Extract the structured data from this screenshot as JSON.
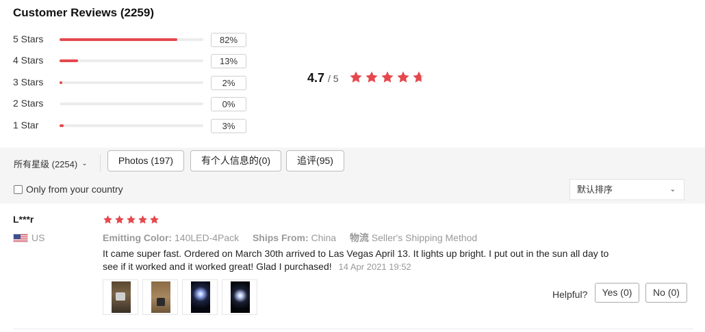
{
  "header": {
    "title": "Customer Reviews (2259)"
  },
  "distribution": [
    {
      "label": "5 Stars",
      "percent_text": "82%",
      "fill_fraction": 0.82
    },
    {
      "label": "4 Stars",
      "percent_text": "13%",
      "fill_fraction": 0.13
    },
    {
      "label": "3 Stars",
      "percent_text": "2%",
      "fill_fraction": 0.02
    },
    {
      "label": "2 Stars",
      "percent_text": "0%",
      "fill_fraction": 0.0
    },
    {
      "label": "1 Star",
      "percent_text": "3%",
      "fill_fraction": 0.03
    }
  ],
  "average": {
    "value": "4.7",
    "out_of": "/ 5",
    "stars_fraction": 0.94
  },
  "filters": {
    "all_stars_select": "所有星级 (2254)",
    "photos_button": "Photos (197)",
    "personal_info_button": "有个人信息的(0)",
    "follow_up_button": "追评(95)",
    "only_country_label": "Only from your country",
    "sort_select": "默认排序"
  },
  "review": {
    "reviewer": "L***r",
    "country": "US",
    "rating": 5,
    "emitting_color_label": "Emitting Color:",
    "emitting_color_value": "140LED-4Pack",
    "ships_from_label": "Ships From:",
    "ships_from_value": "China",
    "logistics_label": "物流",
    "logistics_value": "Seller's Shipping Method",
    "text": "It came super fast. Ordered on March 30th arrived to Las Vegas April 13. It lights up bright. I put out in the sun all day to see if it worked and it worked great! Glad I purchased!",
    "date": "14 Apr 2021 19:52",
    "helpful_label": "Helpful?",
    "yes_label": "Yes (0)",
    "no_label": "No (0)"
  },
  "colors": {
    "accent": "#e5484d",
    "star": "#e5484d",
    "track": "#ececec",
    "filter_bg": "#f5f5f5"
  },
  "icons": {
    "star": "star-icon",
    "chevron": "chevron-down-icon",
    "flag": "us-flag-icon"
  }
}
